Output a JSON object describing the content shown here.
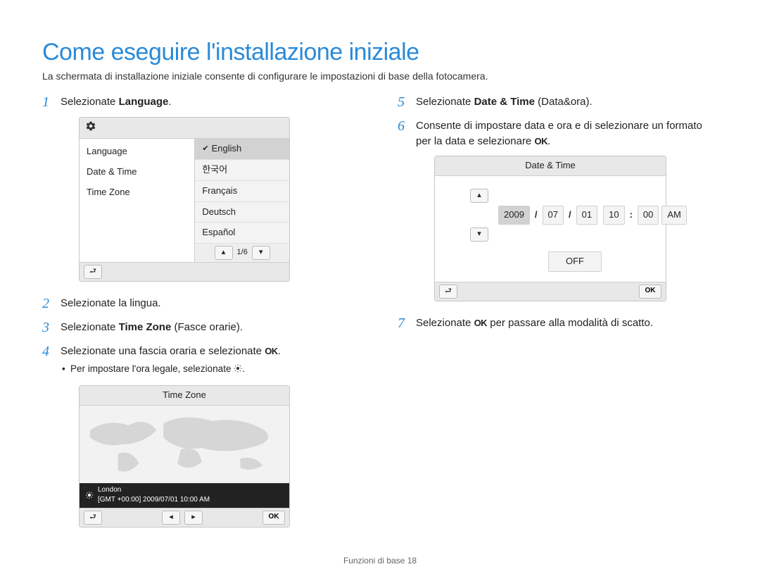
{
  "title": "Come eseguire l'installazione iniziale",
  "subtitle": "La schermata di installazione iniziale consente di configurare le impostazioni di base della fotocamera.",
  "left": {
    "step1": {
      "num": "1",
      "pre": "Selezionate ",
      "bold": "Language",
      "post": "."
    },
    "step2": {
      "num": "2",
      "text": "Selezionate la lingua."
    },
    "step3": {
      "num": "3",
      "pre": "Selezionate ",
      "bold": "Time Zone",
      "post": " (Fasce orarie)."
    },
    "step4": {
      "num": "4",
      "pre": "Selezionate una fascia oraria e selezionate ",
      "ok": "OK",
      "post": "."
    },
    "step4_sub": "Per impostare l'ora legale, selezionate "
  },
  "right": {
    "step5": {
      "num": "5",
      "pre": "Selezionate ",
      "bold": "Date & Time",
      "post": " (Data&ora)."
    },
    "step6": {
      "num": "6",
      "text_a": "Consente di impostare data e ora e di selezionare un formato per la data e selezionare ",
      "ok": "OK",
      "post": "."
    },
    "step7": {
      "num": "7",
      "pre": "Selezionate ",
      "ok": "OK",
      "post": " per passare alla modalità di scatto."
    }
  },
  "lang_screen": {
    "menu": {
      "language": "Language",
      "datetime": "Date & Time",
      "timezone": "Time Zone"
    },
    "options": {
      "en": "English",
      "ko": "한국어",
      "fr": "Français",
      "de": "Deutsch",
      "es": "Español"
    },
    "pager": "1/6"
  },
  "tz_screen": {
    "title": "Time Zone",
    "city": "London",
    "detail": "[GMT +00:00] 2009/07/01 10:00 AM",
    "ok": "OK"
  },
  "dt_screen": {
    "title": "Date & Time",
    "year": "2009",
    "month": "07",
    "day": "01",
    "hour": "10",
    "minute": "00",
    "ampm": "AM",
    "slash": "/",
    "colon": ":",
    "off": "OFF",
    "ok": "OK"
  },
  "footer": {
    "label": "Funzioni di base ",
    "page": "18"
  }
}
